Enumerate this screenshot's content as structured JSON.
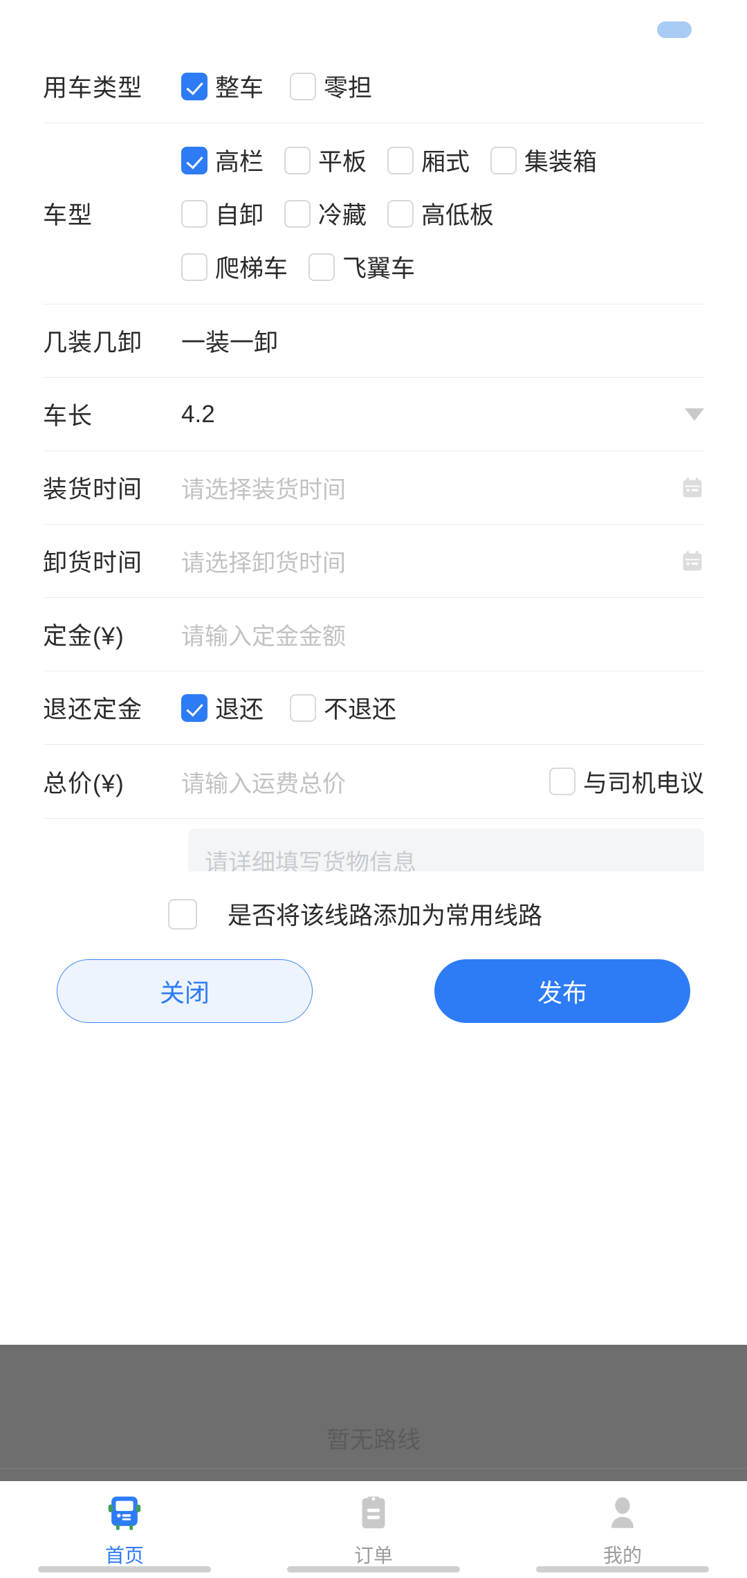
{
  "colors": {
    "accent": "#2D7CF6",
    "accent_light": "#EDF4FE",
    "pill": "#A9CBF4",
    "placeholder": "#C2C2C2",
    "scrim": "#6E6E6E"
  },
  "statusbar": {
    "pill_name": "status-pill"
  },
  "form": {
    "use_type": {
      "label": "用车类型",
      "options": [
        {
          "label": "整车",
          "checked": true
        },
        {
          "label": "零担",
          "checked": false
        }
      ]
    },
    "vehicle_type": {
      "label": "车型",
      "rows": [
        [
          {
            "label": "高栏",
            "checked": true
          },
          {
            "label": "平板",
            "checked": false
          },
          {
            "label": "厢式",
            "checked": false
          },
          {
            "label": "集装箱",
            "checked": false
          }
        ],
        [
          {
            "label": "自卸",
            "checked": false
          },
          {
            "label": "冷藏",
            "checked": false
          },
          {
            "label": "高低板",
            "checked": false
          }
        ],
        [
          {
            "label": "爬梯车",
            "checked": false
          },
          {
            "label": "飞翼车",
            "checked": false
          }
        ]
      ]
    },
    "load_unload": {
      "label": "几装几卸",
      "value": "一装一卸"
    },
    "vehicle_length": {
      "label": "车长",
      "value": "4.2",
      "caret_icon": "chevron-down-icon"
    },
    "load_time": {
      "label": "装货时间",
      "placeholder": "请选择装货时间",
      "value": "",
      "icon": "calendar-icon"
    },
    "unload_time": {
      "label": "卸货时间",
      "placeholder": "请选择卸货时间",
      "value": "",
      "icon": "calendar-icon"
    },
    "deposit": {
      "label": "定金(¥)",
      "placeholder": "请输入定金金额",
      "value": ""
    },
    "refund_deposit": {
      "label": "退还定金",
      "options": [
        {
          "label": "退还",
          "checked": true
        },
        {
          "label": "不退还",
          "checked": false
        }
      ]
    },
    "total_price": {
      "label": "总价(¥)",
      "placeholder": "请输入运费总价",
      "value": "",
      "negotiate": {
        "label": "与司机电议",
        "checked": false
      }
    },
    "cargo_info": {
      "placeholder": "请详细填写货物信息",
      "value": ""
    },
    "common_route": {
      "label": "是否将该线路添加为常用线路",
      "checked": false
    }
  },
  "actions": {
    "close_label": "关闭",
    "publish_label": "发布"
  },
  "empty_state": {
    "text": "暂无路线",
    "icon": "empty-box-icon"
  },
  "tabbar": {
    "items": [
      {
        "label": "首页",
        "icon": "truck-icon",
        "active": true
      },
      {
        "label": "订单",
        "icon": "clipboard-icon",
        "active": false
      },
      {
        "label": "我的",
        "icon": "person-icon",
        "active": false
      }
    ]
  }
}
